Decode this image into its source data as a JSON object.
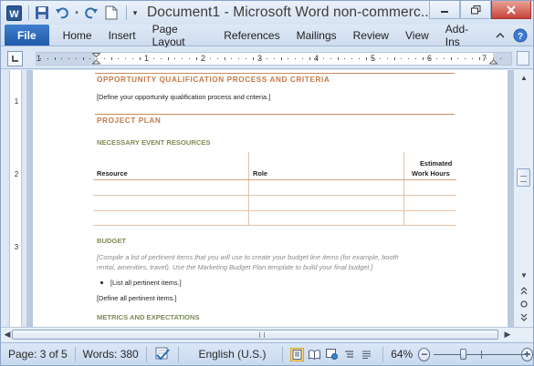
{
  "window": {
    "title": "Document1  -  Microsoft Word non-commerc...",
    "icons": [
      "word-logo-icon",
      "save-icon",
      "undo-icon",
      "redo-icon",
      "new-document-icon",
      "customize-toolbar-icon"
    ]
  },
  "ribbon": {
    "file_label": "File",
    "tabs": [
      "Home",
      "Insert",
      "Page Layout",
      "References",
      "Mailings",
      "Review",
      "View",
      "Add-Ins"
    ]
  },
  "ruler": {
    "numbers": [
      "1",
      "1",
      "2",
      "3",
      "4",
      "5",
      "6",
      "7"
    ],
    "vertical_numbers": [
      "1",
      "2",
      "3"
    ]
  },
  "document": {
    "sections": {
      "opportunity_title": "OPPORTUNITY QUALIFICATION PROCESS AND CRITERIA",
      "opportunity_text": "[Define your opportunity qualification process and criteria.]",
      "project_plan_title": "PROJECT PLAN",
      "resources_title": "NECESSARY EVENT RESOURCES",
      "table_headers": {
        "resource": "Resource",
        "role": "Role",
        "hours_line1": "Estimated",
        "hours_line2": "Work Hours"
      },
      "budget_title": "BUDGET",
      "budget_text_line1": "[Compile a list of pertinent items that you will use to create your budget line items (for example, booth",
      "budget_text_line2": "rental, amenities, travel). Use the Marketing Budget Plan template to build your final budget.]",
      "bullet_item": "[List all pertinent items.]",
      "define_items": "[Define all pertinent items.]",
      "metrics_title": "METRICS AND EXPECTATIONS"
    },
    "colors": {
      "section_title": "#c4794a",
      "subsection_title": "#7d8c57",
      "rule": "#c9885a"
    }
  },
  "statusbar": {
    "page": "Page: 3 of 5",
    "words": "Words: 380",
    "language": "English (U.S.)",
    "zoom": "64%",
    "zoom_value": 64,
    "zoom_out": "−",
    "zoom_in": "+"
  }
}
